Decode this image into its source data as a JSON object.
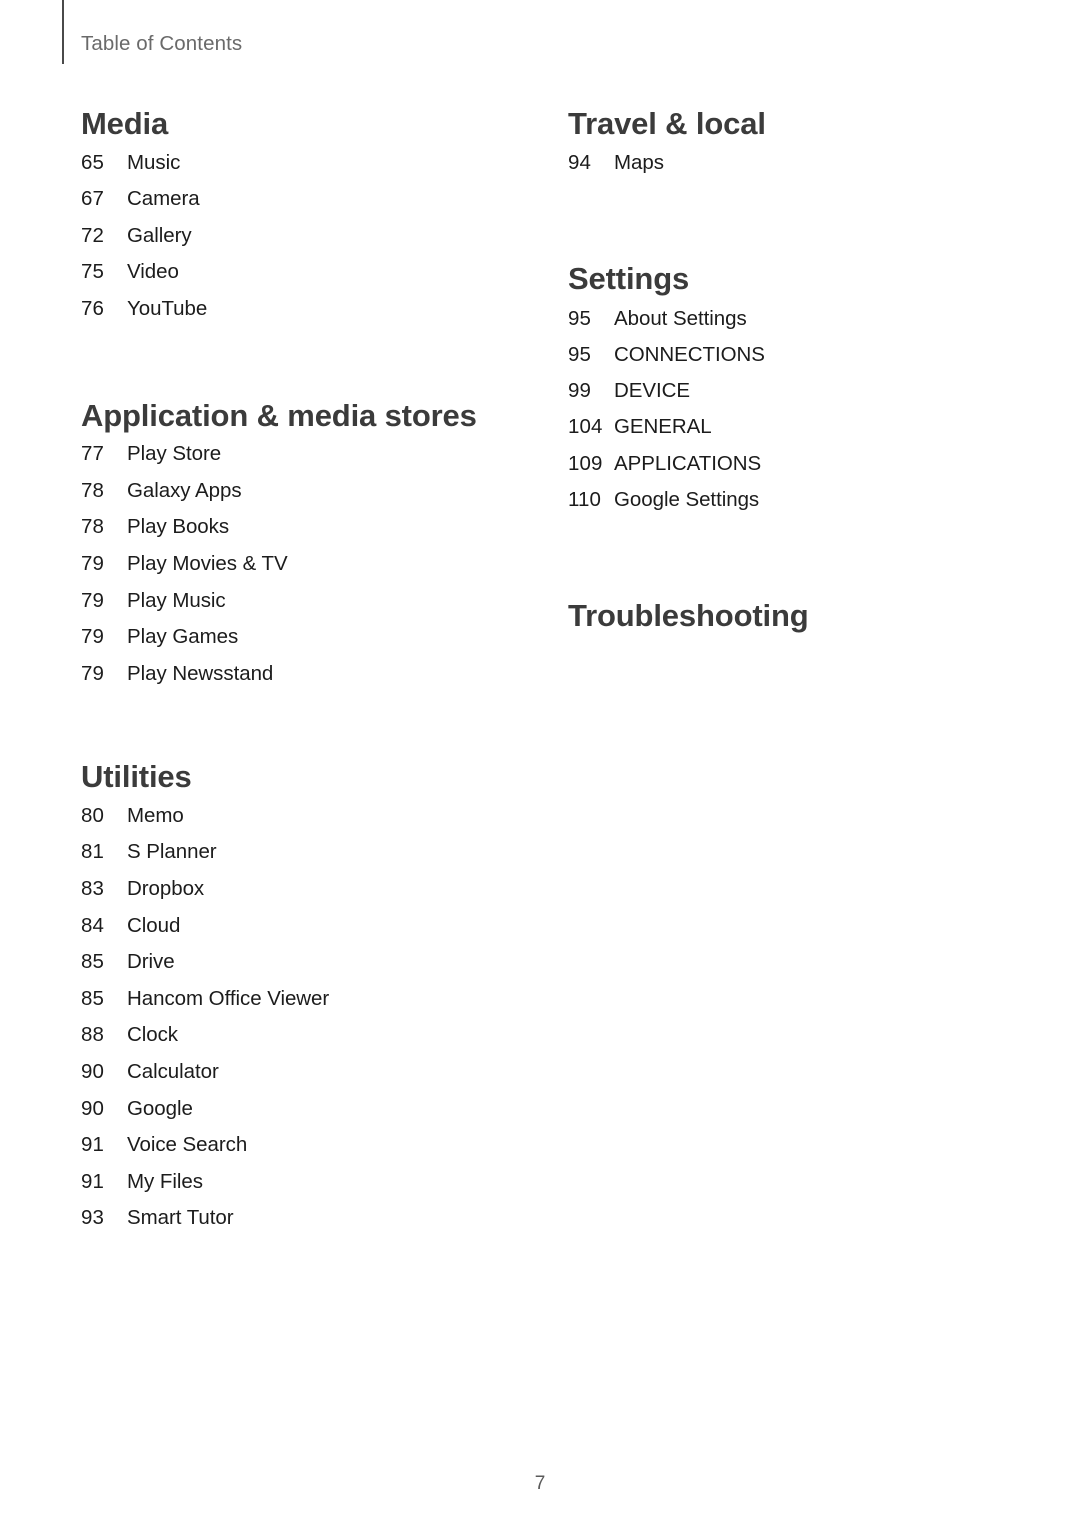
{
  "header": {
    "running_title": "Table of Contents"
  },
  "footer": {
    "page_number": "7"
  },
  "colors": {
    "heading": "#3b3b3b",
    "body_text": "#1c1c1c",
    "running_header": "#6a6a6a",
    "rule": "#4a4a4a",
    "background": "#ffffff"
  },
  "columns": [
    {
      "name": "left-column",
      "sections": [
        {
          "heading": "Media",
          "entries": [
            {
              "page": "65",
              "label": "Music"
            },
            {
              "page": "67",
              "label": "Camera"
            },
            {
              "page": "72",
              "label": "Gallery"
            },
            {
              "page": "75",
              "label": "Video"
            },
            {
              "page": "76",
              "label": "YouTube"
            }
          ]
        },
        {
          "heading": "Application & media stores",
          "entries": [
            {
              "page": "77",
              "label": "Play Store"
            },
            {
              "page": "78",
              "label": "Galaxy Apps"
            },
            {
              "page": "78",
              "label": "Play Books"
            },
            {
              "page": "79",
              "label": "Play Movies & TV"
            },
            {
              "page": "79",
              "label": "Play Music"
            },
            {
              "page": "79",
              "label": "Play Games"
            },
            {
              "page": "79",
              "label": "Play Newsstand"
            }
          ]
        },
        {
          "heading": "Utilities",
          "entries": [
            {
              "page": "80",
              "label": "Memo"
            },
            {
              "page": "81",
              "label": "S Planner"
            },
            {
              "page": "83",
              "label": "Dropbox"
            },
            {
              "page": "84",
              "label": "Cloud"
            },
            {
              "page": "85",
              "label": "Drive"
            },
            {
              "page": "85",
              "label": "Hancom Office Viewer"
            },
            {
              "page": "88",
              "label": "Clock"
            },
            {
              "page": "90",
              "label": "Calculator"
            },
            {
              "page": "90",
              "label": "Google"
            },
            {
              "page": "91",
              "label": "Voice Search"
            },
            {
              "page": "91",
              "label": "My Files"
            },
            {
              "page": "93",
              "label": "Smart Tutor"
            }
          ]
        }
      ]
    },
    {
      "name": "right-column",
      "sections": [
        {
          "heading": "Travel & local",
          "entries": [
            {
              "page": "94",
              "label": "Maps"
            }
          ]
        },
        {
          "heading": "Settings",
          "entries": [
            {
              "page": "95",
              "label": "About Settings"
            },
            {
              "page": "95",
              "label": "CONNECTIONS"
            },
            {
              "page": "99",
              "label": "DEVICE"
            },
            {
              "page": "104",
              "label": "GENERAL"
            },
            {
              "page": "109",
              "label": "APPLICATIONS"
            },
            {
              "page": "110",
              "label": "Google Settings"
            }
          ]
        },
        {
          "heading": "Troubleshooting",
          "entries": []
        }
      ]
    }
  ]
}
